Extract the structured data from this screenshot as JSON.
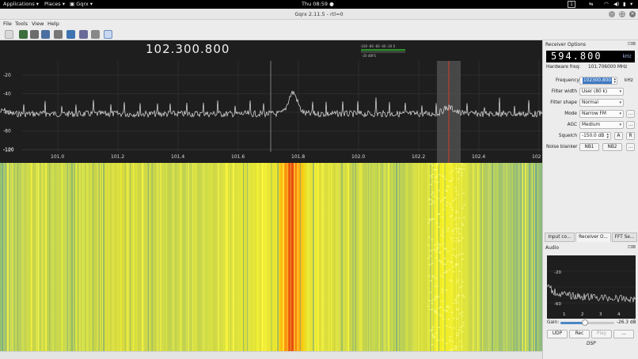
{
  "topbar": {
    "applications": "Applications",
    "places": "Places",
    "app": "Gqrx",
    "clock": "Thu 08:59 ●",
    "workspace": "1"
  },
  "window": {
    "title": "Gqrx 2.11.5 - rtl=0"
  },
  "menu": {
    "file": "File",
    "tools": "Tools",
    "view": "View",
    "help": "Help"
  },
  "plot": {
    "frequency_readout": "102.300.800",
    "y_ticks": [
      "-20",
      "-40",
      "-60",
      "-80",
      "-100",
      "-120"
    ],
    "x_ticks": [
      "101.0",
      "101.2",
      "101.4",
      "101.6",
      "101.8",
      "102.0",
      "102.2",
      "102.4",
      "102"
    ],
    "meter_scale": "-100 -80 -60 -40 -20 0",
    "meter_unit": "-20 dBFS",
    "colors": {
      "background": "#1e1e1e",
      "trace": "#e6e6e6",
      "grid": "#3a3a3a",
      "cursor": "#d23c2a"
    }
  },
  "receiver": {
    "header": "Receiver Options",
    "lcd": "594.800",
    "lcd_unit": "kHz",
    "hw_label": "Hardware freq:",
    "hw_value": "101.706000 MHz",
    "frequency_label": "Frequency",
    "frequency_value": "102300.800",
    "frequency_unit": "kHz",
    "filter_width_label": "Filter width",
    "filter_width_value": "User (80 k)",
    "filter_shape_label": "Filter shape",
    "filter_shape_value": "Normal",
    "mode_label": "Mode",
    "mode_value": "Narrow FM",
    "agc_label": "AGC",
    "agc_value": "Medium",
    "squelch_label": "Squelch",
    "squelch_value": "-150.0 dB",
    "squelch_a": "A",
    "squelch_r": "R",
    "noise_blanker_label": "Noise blanker",
    "nb1": "NB1",
    "nb2": "NB2",
    "more": "..."
  },
  "tabs": [
    "Input co...",
    "Receiver O...",
    "FFT Se..."
  ],
  "audio": {
    "header": "Audio",
    "y_ticks": [
      "-20",
      "-60"
    ],
    "x_ticks": [
      "1",
      "2",
      "3",
      "4"
    ],
    "gain_label": "Gain:",
    "gain_value": "-26.3 dB",
    "udp": "UDP",
    "rec": "Rec",
    "play": "Play",
    "more": "...",
    "dsp": "DSP"
  }
}
